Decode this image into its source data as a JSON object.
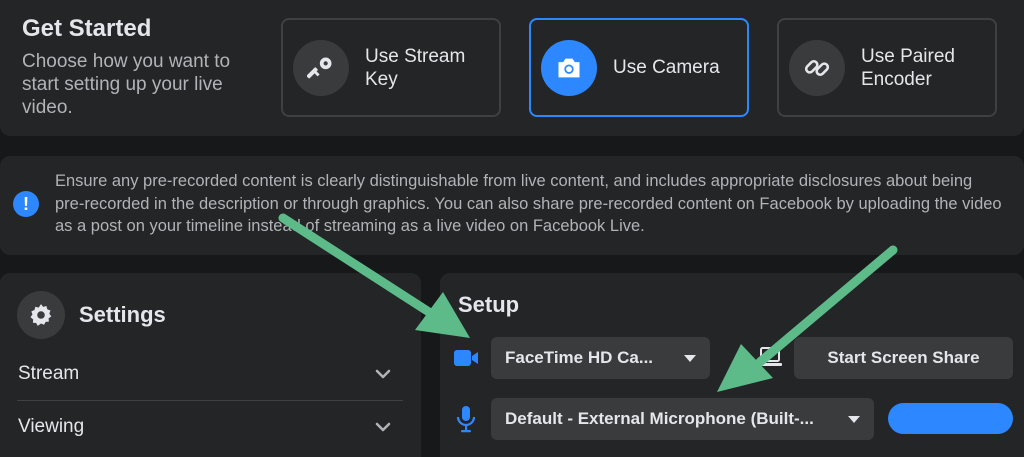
{
  "get_started": {
    "title": "Get Started",
    "description": "Choose how you want to start setting up your live video.",
    "options": [
      {
        "label": "Use Stream Key",
        "icon": "key-icon"
      },
      {
        "label": "Use Camera",
        "icon": "camera-icon",
        "selected": true
      },
      {
        "label": "Use Paired Encoder",
        "icon": "link-icon"
      }
    ]
  },
  "notice": {
    "icon": "exclamation-icon",
    "icon_symbol": "!",
    "text": "Ensure any pre-recorded content is clearly distinguishable from live content, and includes appropriate disclosures about being pre-recorded in the description or through graphics. You can also share pre-recorded content on Facebook by uploading the video as a post on your timeline instead of streaming as a live video on Facebook Live."
  },
  "settings": {
    "title": "Settings",
    "items": [
      {
        "label": "Stream"
      },
      {
        "label": "Viewing"
      }
    ]
  },
  "setup": {
    "title": "Setup",
    "camera_select": "FaceTime HD Ca...",
    "mic_select": "Default - External Microphone (Built-...",
    "screen_share_label": "Start Screen Share"
  },
  "colors": {
    "accent": "#2d88ff",
    "panel": "#242526",
    "background": "#17181a",
    "annotation_arrow": "#5dbb8a"
  }
}
